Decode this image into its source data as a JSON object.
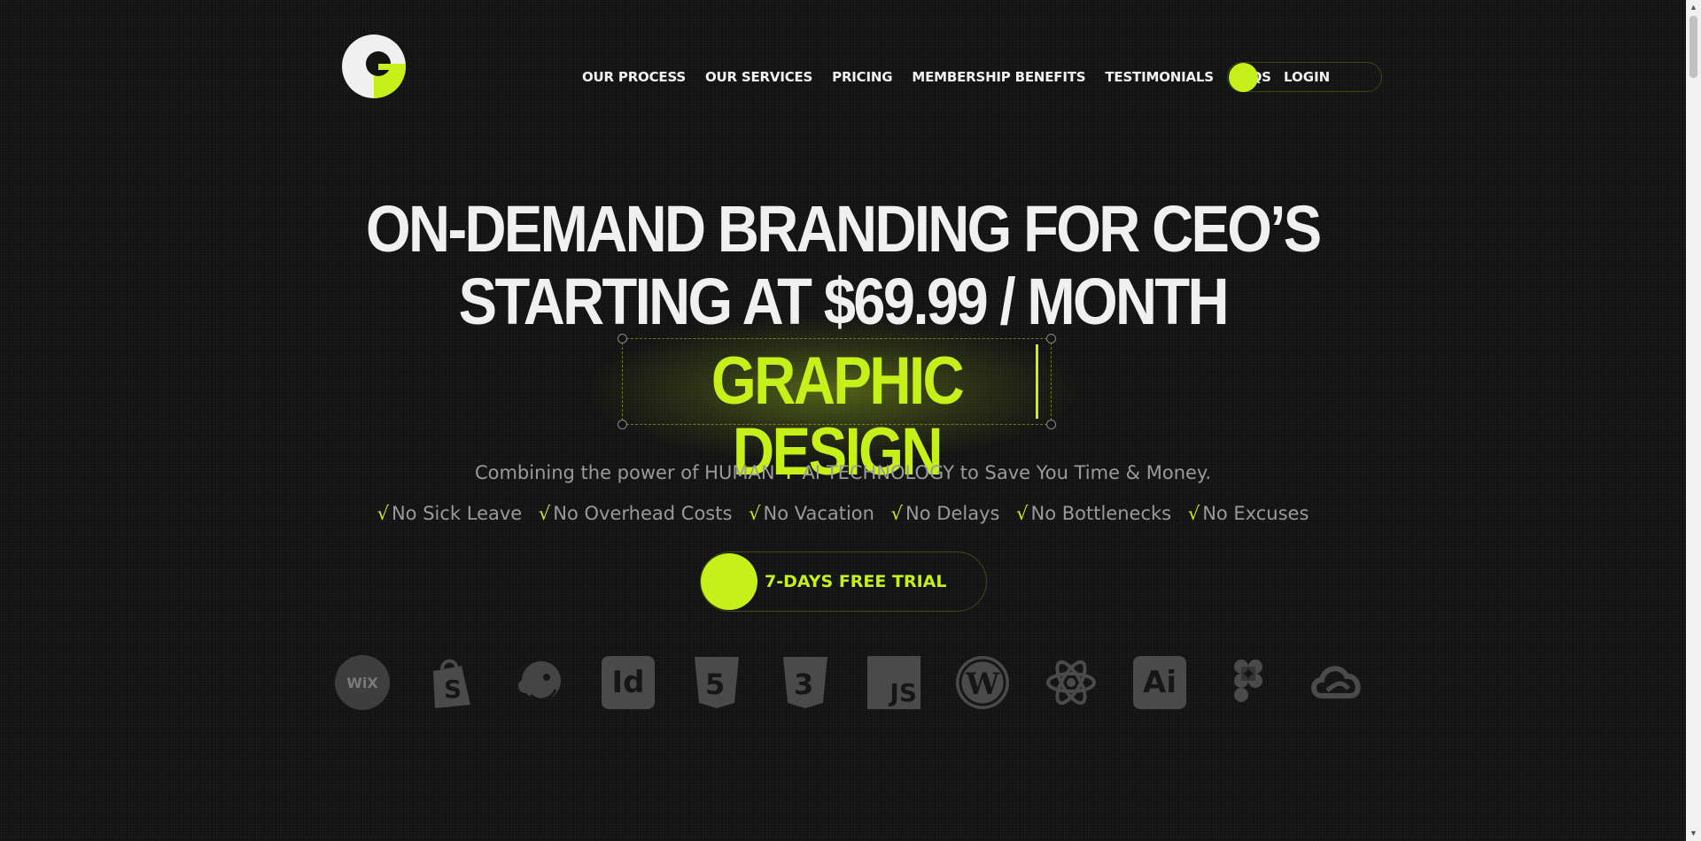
{
  "brand": {
    "logo_name": "brand-logo",
    "accent_color": "#c6f01a",
    "background_color": "#141414"
  },
  "nav": {
    "items": [
      {
        "label": "OUR PROCESS"
      },
      {
        "label": "OUR SERVICES"
      },
      {
        "label": "PRICING"
      },
      {
        "label": "MEMBERSHIP BENEFITS"
      },
      {
        "label": "TESTIMONIALS"
      },
      {
        "label": "FAQS"
      }
    ],
    "login_label": "LOGIN"
  },
  "hero": {
    "headline_line1": "ON-DEMAND BRANDING FOR CEO’S",
    "headline_line2": "STARTING AT $69.99 / MONTH",
    "typed_word": "GRAPHIC DESIGN",
    "subtitle_before": "Combining the power of HUMAN",
    "subtitle_plus": "+",
    "subtitle_after": "AI TECHNOLOGY to Save You Time & Money.",
    "check_symbol": "√",
    "benefits": [
      "No Sick Leave",
      "No Overhead Costs",
      "No Vacation",
      "No Delays",
      "No Bottlenecks",
      "No Excuses"
    ],
    "cta_label": "7-DAYS FREE TRIAL"
  },
  "tools": {
    "icons": [
      {
        "name": "wix-icon",
        "text": "WiX"
      },
      {
        "name": "shopify-icon",
        "text": ""
      },
      {
        "name": "mailchimp-icon",
        "text": ""
      },
      {
        "name": "indesign-icon",
        "text": "Id"
      },
      {
        "name": "html5-icon",
        "text": ""
      },
      {
        "name": "css3-icon",
        "text": ""
      },
      {
        "name": "javascript-icon",
        "text": "JS"
      },
      {
        "name": "wordpress-icon",
        "text": ""
      },
      {
        "name": "react-icon",
        "text": ""
      },
      {
        "name": "illustrator-icon",
        "text": "Ai"
      },
      {
        "name": "figma-icon",
        "text": ""
      },
      {
        "name": "creative-cloud-icon",
        "text": ""
      }
    ]
  }
}
